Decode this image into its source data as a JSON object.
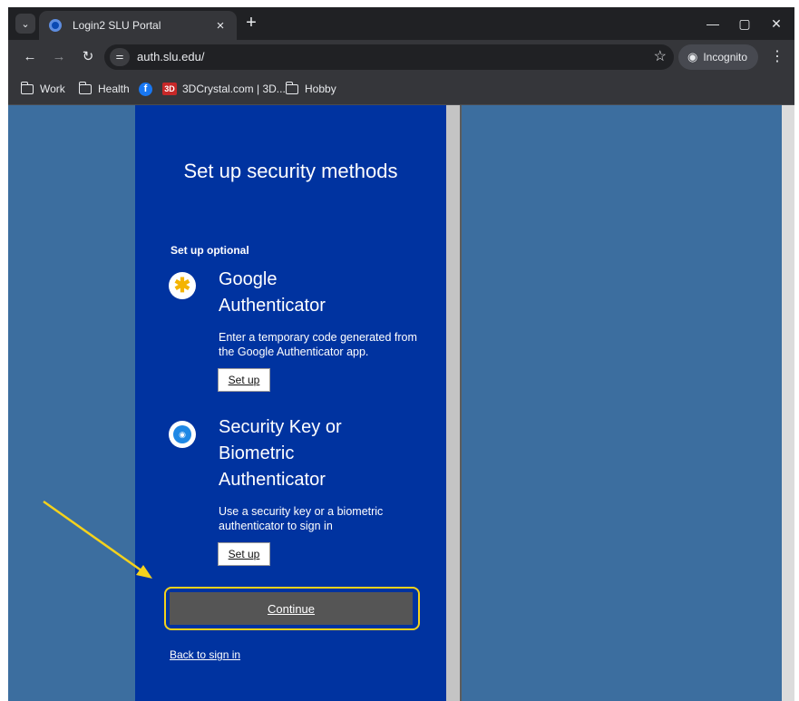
{
  "browser": {
    "tab": {
      "title": "Login2 SLU Portal",
      "close": "×"
    },
    "new_tab": "+",
    "window_controls": {
      "minimize": "—",
      "maximize": "▢",
      "close": "✕"
    },
    "nav": {
      "back": "←",
      "forward": "→",
      "reload": "↻"
    },
    "address": {
      "url": "auth.slu.edu/",
      "site_info_icon": "⚌"
    },
    "bookmark_star": "☆",
    "incognito_label": "Incognito",
    "menu": "⋮",
    "bookmarks": [
      {
        "label": "Work",
        "icon": "folder-icon"
      },
      {
        "label": "Health",
        "icon": "folder-icon"
      },
      {
        "label": "",
        "icon": "facebook-icon"
      },
      {
        "label": "3DCrystal.com | 3D...",
        "icon": "3dcrystal-icon"
      },
      {
        "label": "Hobby",
        "icon": "folder-icon"
      }
    ],
    "favicon_texts": {
      "facebook": "f",
      "crystal": "3D"
    }
  },
  "page": {
    "heading": "Set up security methods",
    "section_label": "Set up optional",
    "methods": [
      {
        "title_lines": [
          "Google",
          "Authenticator"
        ],
        "description": "Enter a temporary code generated from the Google Authenticator app.",
        "button": "Set up",
        "icon": "google-authenticator-icon"
      },
      {
        "title_lines": [
          "Security Key or",
          "Biometric",
          "Authenticator"
        ],
        "description": "Use a security key or a biometric authenticator to sign in",
        "button": "Set up",
        "icon": "security-key-icon"
      }
    ],
    "continue": "Continue",
    "back_link": "Back to sign in"
  },
  "colors": {
    "panel": "#0033a0",
    "background": "#3c6e9f",
    "highlight": "#f5d21c",
    "continue_button": "#555555"
  }
}
